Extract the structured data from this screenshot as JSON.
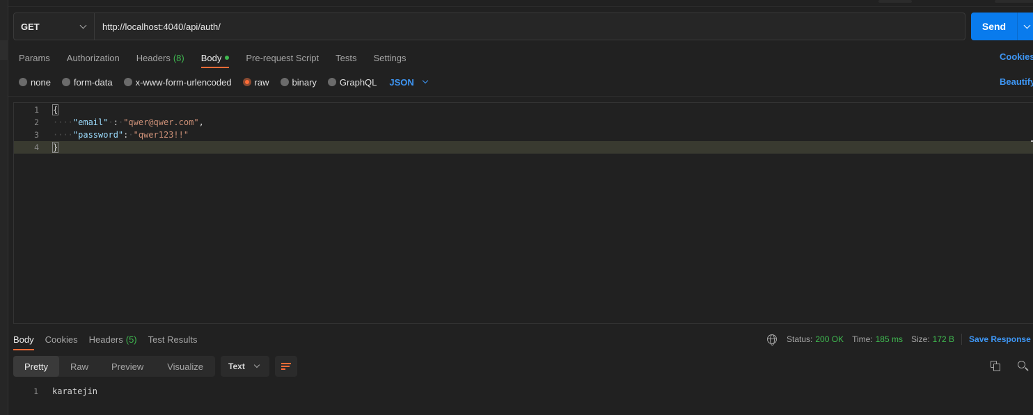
{
  "request": {
    "method": "GET",
    "url": "http://localhost:4040/api/auth/",
    "send_label": "Send"
  },
  "request_tabs": [
    {
      "label": "Params"
    },
    {
      "label": "Authorization"
    },
    {
      "label": "Headers",
      "count": "(8)"
    },
    {
      "label": "Body",
      "active": true
    },
    {
      "label": "Pre-request Script"
    },
    {
      "label": "Tests"
    },
    {
      "label": "Settings"
    }
  ],
  "cookies_label": "Cookies",
  "body_types": [
    "none",
    "form-data",
    "x-www-form-urlencoded",
    "raw",
    "binary",
    "GraphQL"
  ],
  "body_type_selected": "raw",
  "body_format": "JSON",
  "beautify_label": "Beautify",
  "editor": {
    "line_numbers": [
      "1",
      "2",
      "3",
      "4"
    ],
    "lines": {
      "l1": "{",
      "l2_key": "\"email\"",
      "l2_colon": ":",
      "l2_val": "\"qwer@qwer.com\"",
      "l2_comma": ",",
      "l3_key": "\"password\"",
      "l3_colon": ":",
      "l3_val": "\"qwer123!!\"",
      "l4": "}"
    }
  },
  "response_tabs": [
    {
      "label": "Body",
      "active": true
    },
    {
      "label": "Cookies"
    },
    {
      "label": "Headers",
      "count": "(5)"
    },
    {
      "label": "Test Results"
    }
  ],
  "response_meta": {
    "status_label": "Status:",
    "status_value": "200 OK",
    "time_label": "Time:",
    "time_value": "185 ms",
    "size_label": "Size:",
    "size_value": "172 B",
    "save_label": "Save Response"
  },
  "response_views": [
    "Pretty",
    "Raw",
    "Preview",
    "Visualize"
  ],
  "response_format": "Text",
  "response_body": {
    "line_number": "1",
    "text": "karatejin"
  },
  "colors": {
    "accent": "#ff6c37",
    "link": "#3e96f4",
    "send": "#097bed",
    "success": "#3fb950"
  }
}
